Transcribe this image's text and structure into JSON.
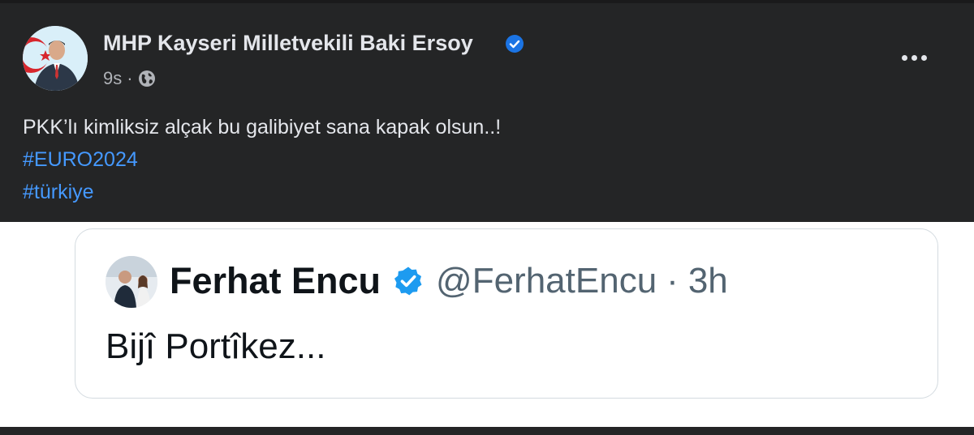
{
  "post": {
    "author": "MHP Kayseri Milletvekili Baki Ersoy",
    "time": "9s",
    "dot": "·",
    "text": "PKK’lı kimliksiz alçak bu galibiyet sana kapak olsun..!",
    "hashtags": [
      "#EURO2024",
      "#türkiye"
    ],
    "icons": {
      "verified": "verified-badge-icon",
      "audience": "globe-icon",
      "more": "more-options-icon"
    },
    "colors": {
      "background": "#242526",
      "text": "#e4e6eb",
      "hashtag": "#4599ff",
      "verified": "#1b74e4"
    }
  },
  "embedded_tweet": {
    "name": "Ferhat Encu",
    "handle": "@FerhatEncu",
    "separator": "·",
    "time": "3h",
    "text": "Bijî Portîkez...",
    "icons": {
      "verified": "verified-badge-icon"
    },
    "colors": {
      "verified": "#1d9bf0",
      "name": "#0f1419",
      "handle": "#536471"
    }
  }
}
